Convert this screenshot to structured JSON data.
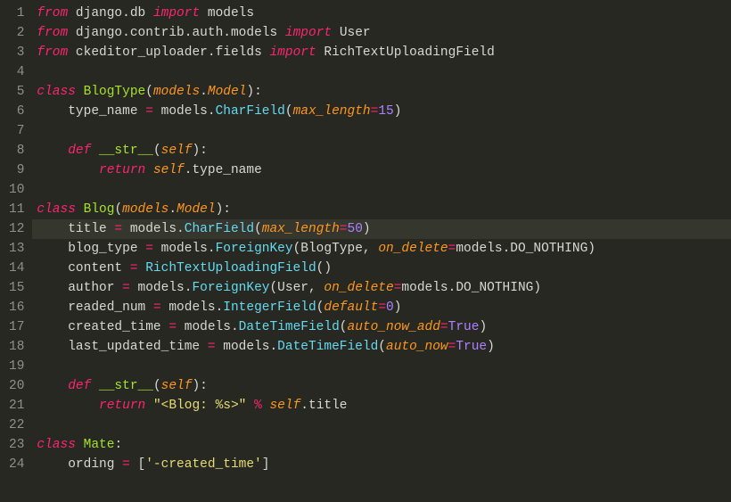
{
  "lines": [
    {
      "num": "1",
      "tokens": [
        [
          "kw",
          "from"
        ],
        [
          "pln",
          " django"
        ],
        [
          "pln",
          "."
        ],
        [
          "pln",
          "db "
        ],
        [
          "kw",
          "import"
        ],
        [
          "pln",
          " models"
        ]
      ]
    },
    {
      "num": "2",
      "tokens": [
        [
          "kw",
          "from"
        ],
        [
          "pln",
          " django"
        ],
        [
          "pln",
          "."
        ],
        [
          "pln",
          "contrib"
        ],
        [
          "pln",
          "."
        ],
        [
          "pln",
          "auth"
        ],
        [
          "pln",
          "."
        ],
        [
          "pln",
          "models "
        ],
        [
          "kw",
          "import"
        ],
        [
          "pln",
          " User"
        ]
      ]
    },
    {
      "num": "3",
      "tokens": [
        [
          "kw",
          "from"
        ],
        [
          "pln",
          " ckeditor_uploader"
        ],
        [
          "pln",
          "."
        ],
        [
          "pln",
          "fields "
        ],
        [
          "kw",
          "import"
        ],
        [
          "pln",
          " RichTextUploadingField"
        ]
      ]
    },
    {
      "num": "4",
      "tokens": []
    },
    {
      "num": "5",
      "tokens": [
        [
          "kw",
          "class"
        ],
        [
          "pln",
          " "
        ],
        [
          "cls",
          "BlogType"
        ],
        [
          "pln",
          "("
        ],
        [
          "arg",
          "models"
        ],
        [
          "pln",
          "."
        ],
        [
          "arg",
          "Model"
        ],
        [
          "pln",
          "):"
        ]
      ]
    },
    {
      "num": "6",
      "tokens": [
        [
          "pln",
          "    type_name "
        ],
        [
          "op",
          "="
        ],
        [
          "pln",
          " models"
        ],
        [
          "pln",
          "."
        ],
        [
          "fn",
          "CharField"
        ],
        [
          "pln",
          "("
        ],
        [
          "arg",
          "max_length"
        ],
        [
          "op",
          "="
        ],
        [
          "num",
          "15"
        ],
        [
          "pln",
          ")"
        ]
      ]
    },
    {
      "num": "7",
      "tokens": []
    },
    {
      "num": "8",
      "tokens": [
        [
          "pln",
          "    "
        ],
        [
          "kw",
          "def"
        ],
        [
          "pln",
          " "
        ],
        [
          "cls",
          "__str__"
        ],
        [
          "pln",
          "("
        ],
        [
          "arg",
          "self"
        ],
        [
          "pln",
          "):"
        ]
      ]
    },
    {
      "num": "9",
      "tokens": [
        [
          "pln",
          "        "
        ],
        [
          "kw",
          "return"
        ],
        [
          "pln",
          " "
        ],
        [
          "arg",
          "self"
        ],
        [
          "pln",
          "."
        ],
        [
          "pln",
          "type_name"
        ]
      ]
    },
    {
      "num": "10",
      "tokens": []
    },
    {
      "num": "11",
      "tokens": [
        [
          "kw",
          "class"
        ],
        [
          "pln",
          " "
        ],
        [
          "cls",
          "Blog"
        ],
        [
          "pln",
          "("
        ],
        [
          "arg",
          "models"
        ],
        [
          "pln",
          "."
        ],
        [
          "arg",
          "Model"
        ],
        [
          "pln",
          "):"
        ]
      ]
    },
    {
      "num": "12",
      "tokens": [
        [
          "pln",
          "    title "
        ],
        [
          "op",
          "="
        ],
        [
          "pln",
          " models"
        ],
        [
          "pln",
          "."
        ],
        [
          "fn",
          "CharField"
        ],
        [
          "pln",
          "("
        ],
        [
          "arg",
          "max_length"
        ],
        [
          "op",
          "="
        ],
        [
          "num",
          "50"
        ],
        [
          "pln",
          ")"
        ]
      ],
      "highlight": true
    },
    {
      "num": "13",
      "tokens": [
        [
          "pln",
          "    blog_type "
        ],
        [
          "op",
          "="
        ],
        [
          "pln",
          " models"
        ],
        [
          "pln",
          "."
        ],
        [
          "fn",
          "ForeignKey"
        ],
        [
          "pln",
          "(BlogType"
        ],
        [
          "pln",
          ", "
        ],
        [
          "arg",
          "on_delete"
        ],
        [
          "op",
          "="
        ],
        [
          "pln",
          "models"
        ],
        [
          "pln",
          "."
        ],
        [
          "pln",
          "DO_NOTHING"
        ],
        [
          "pln",
          ")"
        ]
      ]
    },
    {
      "num": "14",
      "tokens": [
        [
          "pln",
          "    content "
        ],
        [
          "op",
          "="
        ],
        [
          "pln",
          " "
        ],
        [
          "fn",
          "RichTextUploadingField"
        ],
        [
          "pln",
          "()"
        ]
      ]
    },
    {
      "num": "15",
      "tokens": [
        [
          "pln",
          "    author "
        ],
        [
          "op",
          "="
        ],
        [
          "pln",
          " models"
        ],
        [
          "pln",
          "."
        ],
        [
          "fn",
          "ForeignKey"
        ],
        [
          "pln",
          "(User"
        ],
        [
          "pln",
          ", "
        ],
        [
          "arg",
          "on_delete"
        ],
        [
          "op",
          "="
        ],
        [
          "pln",
          "models"
        ],
        [
          "pln",
          "."
        ],
        [
          "pln",
          "DO_NOTHING"
        ],
        [
          "pln",
          ")"
        ]
      ]
    },
    {
      "num": "16",
      "tokens": [
        [
          "pln",
          "    readed_num "
        ],
        [
          "op",
          "="
        ],
        [
          "pln",
          " models"
        ],
        [
          "pln",
          "."
        ],
        [
          "fn",
          "IntegerField"
        ],
        [
          "pln",
          "("
        ],
        [
          "arg",
          "default"
        ],
        [
          "op",
          "="
        ],
        [
          "num",
          "0"
        ],
        [
          "pln",
          ")"
        ]
      ]
    },
    {
      "num": "17",
      "tokens": [
        [
          "pln",
          "    created_time "
        ],
        [
          "op",
          "="
        ],
        [
          "pln",
          " models"
        ],
        [
          "pln",
          "."
        ],
        [
          "fn",
          "DateTimeField"
        ],
        [
          "pln",
          "("
        ],
        [
          "arg",
          "auto_now_add"
        ],
        [
          "op",
          "="
        ],
        [
          "num",
          "True"
        ],
        [
          "pln",
          ")"
        ]
      ]
    },
    {
      "num": "18",
      "tokens": [
        [
          "pln",
          "    last_updated_time "
        ],
        [
          "op",
          "="
        ],
        [
          "pln",
          " models"
        ],
        [
          "pln",
          "."
        ],
        [
          "fn",
          "DateTimeField"
        ],
        [
          "pln",
          "("
        ],
        [
          "arg",
          "auto_now"
        ],
        [
          "op",
          "="
        ],
        [
          "num",
          "True"
        ],
        [
          "pln",
          ")"
        ]
      ]
    },
    {
      "num": "19",
      "tokens": []
    },
    {
      "num": "20",
      "tokens": [
        [
          "pln",
          "    "
        ],
        [
          "kw",
          "def"
        ],
        [
          "pln",
          " "
        ],
        [
          "cls",
          "__str__"
        ],
        [
          "pln",
          "("
        ],
        [
          "arg",
          "self"
        ],
        [
          "pln",
          "):"
        ]
      ]
    },
    {
      "num": "21",
      "tokens": [
        [
          "pln",
          "        "
        ],
        [
          "kw",
          "return"
        ],
        [
          "pln",
          " "
        ],
        [
          "str",
          "\"<Blog: %s>\""
        ],
        [
          "pln",
          " "
        ],
        [
          "op",
          "%"
        ],
        [
          "pln",
          " "
        ],
        [
          "arg",
          "self"
        ],
        [
          "pln",
          "."
        ],
        [
          "pln",
          "title"
        ]
      ]
    },
    {
      "num": "22",
      "tokens": []
    },
    {
      "num": "23",
      "tokens": [
        [
          "kw",
          "class"
        ],
        [
          "pln",
          " "
        ],
        [
          "cls",
          "Mate"
        ],
        [
          "pln",
          ":"
        ]
      ]
    },
    {
      "num": "24",
      "tokens": [
        [
          "pln",
          "    ording "
        ],
        [
          "op",
          "="
        ],
        [
          "pln",
          " ["
        ],
        [
          "str",
          "'-created_time'"
        ],
        [
          "pln",
          "]"
        ]
      ]
    }
  ]
}
